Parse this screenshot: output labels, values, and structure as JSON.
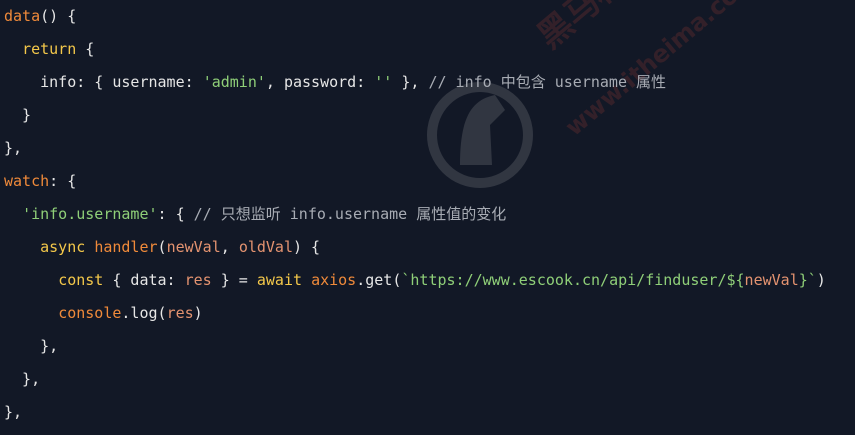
{
  "colors": {
    "background": "#121826",
    "default": "#e6e6e6",
    "keyword": "#f4c84a",
    "function": "#f08a3a",
    "string": "#8fcf78",
    "comment": "#a8acb4",
    "variable": "#e49370"
  },
  "watermark": {
    "text_cn": "黑马程序员",
    "text_url": "www.itheima.com",
    "icon": "horse-logo-icon"
  },
  "code": {
    "lines": [
      [
        {
          "t": "data",
          "k": "function"
        },
        {
          "t": "() {",
          "k": "default"
        }
      ],
      [
        {
          "t": "  ",
          "k": "default"
        },
        {
          "t": "return",
          "k": "keyword"
        },
        {
          "t": " {",
          "k": "default"
        }
      ],
      [
        {
          "t": "    info: { username: ",
          "k": "default"
        },
        {
          "t": "'admin'",
          "k": "string"
        },
        {
          "t": ", password: ",
          "k": "default"
        },
        {
          "t": "''",
          "k": "string"
        },
        {
          "t": " }, ",
          "k": "default"
        },
        {
          "t": "// info 中包含 username 属性",
          "k": "comment"
        }
      ],
      [
        {
          "t": "  }",
          "k": "default"
        }
      ],
      [
        {
          "t": "},",
          "k": "default"
        }
      ],
      [
        {
          "t": "watch",
          "k": "function"
        },
        {
          "t": ": {",
          "k": "default"
        }
      ],
      [
        {
          "t": "  ",
          "k": "default"
        },
        {
          "t": "'info.username'",
          "k": "string"
        },
        {
          "t": ": { ",
          "k": "default"
        },
        {
          "t": "// 只想监听 info.username 属性值的变化",
          "k": "comment"
        }
      ],
      [
        {
          "t": "    ",
          "k": "default"
        },
        {
          "t": "async",
          "k": "keyword"
        },
        {
          "t": " ",
          "k": "default"
        },
        {
          "t": "handler",
          "k": "function"
        },
        {
          "t": "(",
          "k": "default"
        },
        {
          "t": "newVal",
          "k": "variable"
        },
        {
          "t": ", ",
          "k": "default"
        },
        {
          "t": "oldVal",
          "k": "variable"
        },
        {
          "t": ") {",
          "k": "default"
        }
      ],
      [
        {
          "t": "      ",
          "k": "default"
        },
        {
          "t": "const",
          "k": "keyword"
        },
        {
          "t": " { data: ",
          "k": "default"
        },
        {
          "t": "res",
          "k": "variable"
        },
        {
          "t": " } = ",
          "k": "default"
        },
        {
          "t": "await",
          "k": "keyword"
        },
        {
          "t": " ",
          "k": "default"
        },
        {
          "t": "axios",
          "k": "function"
        },
        {
          "t": ".get(",
          "k": "default"
        },
        {
          "t": "`https://www.escook.cn/api/finduser/${",
          "k": "string"
        },
        {
          "t": "newVal",
          "k": "variable"
        },
        {
          "t": "}`",
          "k": "string"
        },
        {
          "t": ")",
          "k": "default"
        }
      ],
      [
        {
          "t": "      ",
          "k": "default"
        },
        {
          "t": "console",
          "k": "function"
        },
        {
          "t": ".log(",
          "k": "default"
        },
        {
          "t": "res",
          "k": "variable"
        },
        {
          "t": ")",
          "k": "default"
        }
      ],
      [
        {
          "t": "    },",
          "k": "default"
        }
      ],
      [
        {
          "t": "  },",
          "k": "default"
        }
      ],
      [
        {
          "t": "},",
          "k": "default"
        }
      ]
    ]
  }
}
